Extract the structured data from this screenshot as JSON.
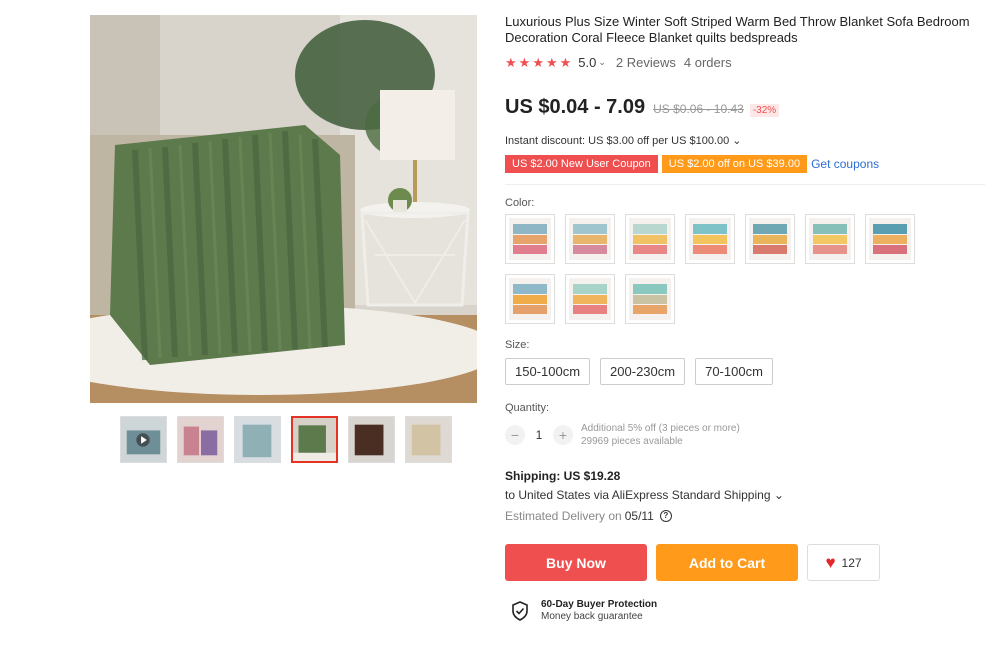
{
  "product": {
    "title": "Luxurious Plus Size Winter Soft Striped Warm Bed Throw Blanket Sofa Bedroom Decoration Coral Fleece Blanket quilts bedspreads",
    "rating": "5.0",
    "rating_caret": "⌄",
    "reviews": "2 Reviews",
    "orders": "4 orders",
    "stars_icon": "star-icon",
    "star_glyph": "★"
  },
  "price": {
    "current": "US $0.04 - 7.09",
    "original": "US $0.06 - 10.43",
    "discount": "-32%"
  },
  "discount": {
    "instant": "Instant discount: US $3.00 off per US $100.00 ⌄"
  },
  "coupons": {
    "new_user": "US $2.00 New User Coupon",
    "order_off": "US $2.00 off on US $39.00",
    "get_coupons": "Get coupons"
  },
  "color": {
    "label": "Color:"
  },
  "size": {
    "label": "Size:",
    "options": [
      "150-100cm",
      "200-230cm",
      "70-100cm"
    ]
  },
  "quantity": {
    "label": "Quantity:",
    "value": "1",
    "minus": "−",
    "plus": "+",
    "note_line1": "Additional 5% off (3 pieces or more)",
    "note_line2": "29969 pieces available"
  },
  "shipping": {
    "title": "Shipping: US $19.28",
    "destination": "to United States via AliExpress Standard Shipping ⌄",
    "estimated_label": "Estimated Delivery on",
    "estimated_date": "05/11",
    "help_glyph": "?"
  },
  "actions": {
    "buy_now": "Buy Now",
    "add_to_cart": "Add to Cart",
    "wishlist_count": "127",
    "heart_glyph": "♥"
  },
  "protection": {
    "title": "60-Day Buyer Protection",
    "subtitle": "Money back guarantee"
  },
  "colors": {
    "accent_red": "#f04f4f",
    "accent_orange": "#ff9a1b",
    "link_blue": "#2c6fd2",
    "blanket_green": "#5d7a4c"
  },
  "icons": [
    "star-icon",
    "caret-down-icon",
    "help-icon",
    "heart-icon",
    "shield-check-icon",
    "play-icon"
  ]
}
